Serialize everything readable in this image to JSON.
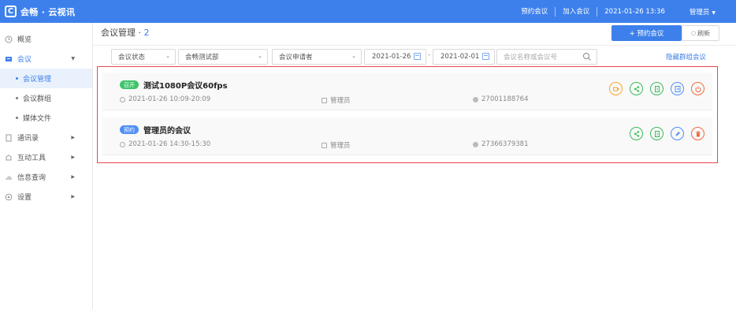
{
  "topbar": {
    "logo_mark": "C",
    "logo_text": "会畅 · 云视讯",
    "links": [
      "预约会议",
      "加入会议"
    ],
    "datetime": "2021-01-26 13:36",
    "user": "管理员",
    "caret": "▼"
  },
  "sidebar": {
    "items": [
      {
        "label": "概览",
        "icon": "clock-icon"
      },
      {
        "label": "会议",
        "icon": "meeting-icon",
        "expanded": true
      },
      {
        "label": "会议管理",
        "sub": true,
        "active": true
      },
      {
        "label": "会议群组",
        "sub": true
      },
      {
        "label": "媒体文件",
        "sub": true
      },
      {
        "label": "通讯录",
        "icon": "contacts-icon"
      },
      {
        "label": "互动工具",
        "icon": "tool-icon"
      },
      {
        "label": "信息查询",
        "icon": "chart-icon"
      },
      {
        "label": "设置",
        "icon": "gear-icon"
      }
    ]
  },
  "main": {
    "title": "会议管理 · ",
    "count": "2",
    "book_button": "+ 预约会议",
    "refresh_button": "刷新",
    "hide_link": "隐藏群组会议",
    "filters": {
      "status": "会议状态",
      "department": "会畅测试部",
      "applicant": "会议申请者",
      "date_from": "2021-01-26",
      "date_to": "2021-02-01",
      "date_separator": "-",
      "search_placeholder": "会议名称或会议号"
    },
    "meetings": [
      {
        "badge": "召开",
        "badge_color": "#3fc46b",
        "title": "测试1080P会议60fps",
        "time": "2021-01-26 10:09-20:09",
        "host": "管理员",
        "number": "27001188764",
        "actions": [
          "record-icon",
          "share-icon",
          "doc-icon",
          "enter-icon",
          "power-icon"
        ]
      },
      {
        "badge": "预约",
        "badge_color": "#4f8ef7",
        "title": "管理员的会议",
        "time": "2021-01-26 14:30-15:30",
        "host": "管理员",
        "number": "27366379381",
        "actions": [
          "share-icon",
          "doc-icon",
          "edit-icon",
          "delete-icon"
        ]
      }
    ]
  },
  "colors": {
    "accent": "#3d80eb",
    "highlight_border": "#e8474c"
  }
}
